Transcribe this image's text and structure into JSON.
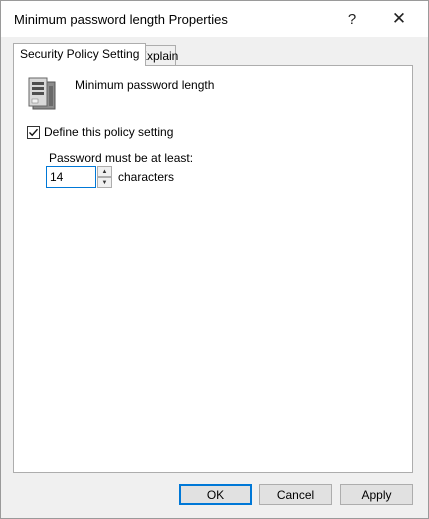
{
  "window": {
    "title": "Minimum password length Properties",
    "help_glyph": "?",
    "close_glyph": "✕"
  },
  "tabs": [
    {
      "label": "Security Policy Setting",
      "active": true
    },
    {
      "label": "Explain",
      "active": false
    }
  ],
  "panel": {
    "policy_name": "Minimum password length",
    "policy_icon": "server-policy-icon",
    "define_checkbox": {
      "label": "Define this policy setting",
      "checked": true
    },
    "password_label": "Password must be at least:",
    "length_value": "14",
    "units_label": "characters",
    "spin_up": "▲",
    "spin_down": "▼"
  },
  "buttons": {
    "ok": "OK",
    "cancel": "Cancel",
    "apply": "Apply"
  },
  "colors": {
    "accent": "#0078d7",
    "dialog_bg": "#f0f0f0",
    "button_bg": "#e1e1e1"
  }
}
